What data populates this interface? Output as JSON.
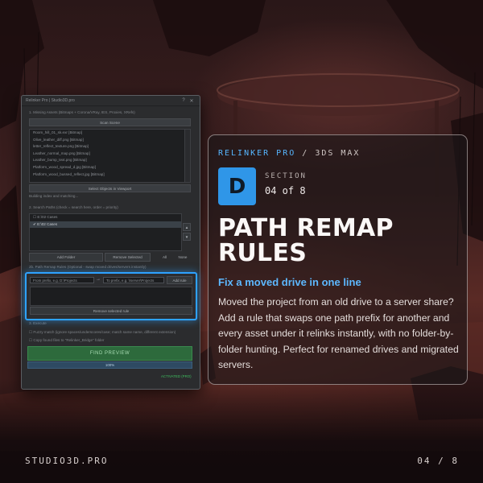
{
  "window": {
    "title": "Relinker Pro | Studio3D.pro",
    "section1_label": "1. Missing Assets (Bitmaps + Corona/VRay, IES, Proxies, XRefs)",
    "scan_button": "Scan Scene",
    "missing_files": [
      "Room_hill_01_sk.exr [Bitmap]",
      "Olive_leather_diff.png [Bitmap]",
      "letter_reflect_texture.png [Bitmap]",
      "Leather_normal_map.png [Bitmap]",
      "Leather_bump_text.png [Bitmap]",
      "Platform_wood_spread_d.jpg [Bitmap]",
      "Platform_wood_bussed_reflect.jpg [Bitmap]"
    ],
    "select_objects_button": "Select Objects in Viewport",
    "status_text": "Building index and matching...",
    "section2_label": "2. Search Paths (check = search here, order = priority)",
    "search_paths": [
      "E:\\02 Cases",
      "E:\\02 Cases"
    ],
    "add_folder_button": "Add Folder",
    "remove_selected_button": "Remove Selected",
    "all_button": "All",
    "none_button": "None",
    "section2b_label": "2b. Path Remap Rules (Optional - swap moved drives/servers instantly)",
    "from_placeholder": "From prefix, e.g.  D:\\Projects",
    "arrow": "→",
    "to_placeholder": "To prefix, e.g.  \\\\server\\Projects",
    "add_rule_button": "Add rule",
    "remove_rule_button": "Remove selected rule",
    "section3_label": "3. Execute",
    "fuzzy_option": "Fuzzy match (ignore spaces/underscores/case; match same name, different extension)",
    "copy_option": "Copy found files to \"Relinker_Bridge\" folder",
    "find_preview_button": "FIND PREVIEW",
    "progress": "100%",
    "progress_value": 1.0,
    "activated": "ACTIVATED (PRO)"
  },
  "card": {
    "brand": "RELINKER PRO",
    "separator": " / ",
    "host": "3DS MAX",
    "badge_letter": "D",
    "section_word": "SECTION",
    "section_num": "04 of 8",
    "headline": "PATH REMAP RULES",
    "subhead": "Fix a moved drive in one line",
    "body": "Moved the project from an old drive to a server share? Add a rule that swaps one path prefix for another and every asset under it relinks instantly, with no folder-by-folder hunting. Perfect for renamed drives and migrated servers."
  },
  "footer": {
    "site": "STUDIO3D.PRO",
    "page": "04 / 8"
  },
  "colors": {
    "accent": "#2f96e8",
    "highlight": "#2ea2ff",
    "find_button": "#2d6a3c"
  }
}
